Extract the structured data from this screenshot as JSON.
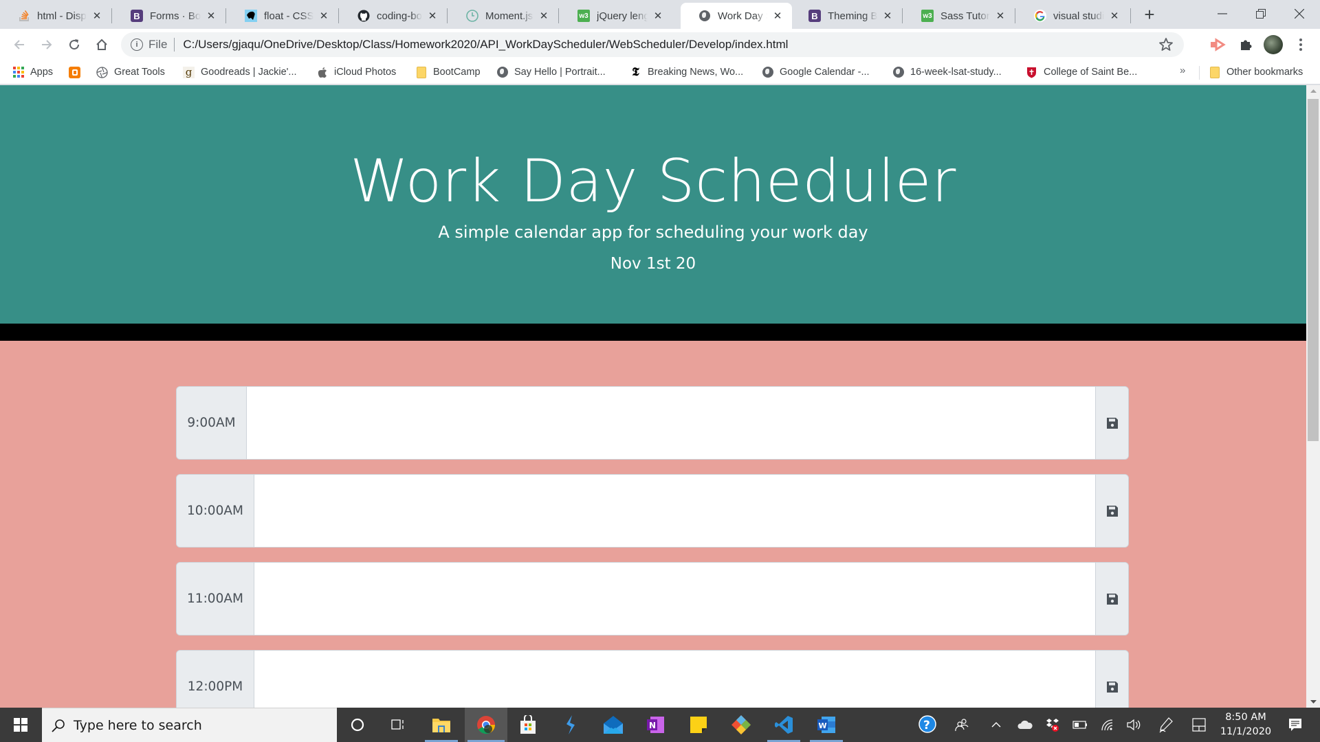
{
  "browser": {
    "tabs": [
      {
        "title": "html - Display",
        "icon": "stackoverflow-icon",
        "active": false
      },
      {
        "title": "Forms · Bootstrap",
        "icon": "bootstrap-icon",
        "active": false
      },
      {
        "title": "float - CSS: C",
        "icon": "mdn-icon",
        "active": false
      },
      {
        "title": "coding-boot",
        "icon": "github-icon",
        "active": false
      },
      {
        "title": "Moment.js |",
        "icon": "moment-icon",
        "active": false
      },
      {
        "title": "jQuery length",
        "icon": "w3schools-icon",
        "active": false
      },
      {
        "title": "Work Day Sc",
        "icon": "globe-icon",
        "active": true
      },
      {
        "title": "Theming Boo",
        "icon": "bootstrap-icon",
        "active": false
      },
      {
        "title": "Sass Tutorial",
        "icon": "w3schools-icon",
        "active": false
      },
      {
        "title": "visual studio",
        "icon": "google-icon",
        "active": false
      }
    ],
    "new_tab_label": "+",
    "address": {
      "scheme_label": "File",
      "url": "C:/Users/gjaqu/OneDrive/Desktop/Class/Homework2020/API_WorkDayScheduler/WebScheduler/Develop/index.html"
    },
    "bookmarks": [
      {
        "label": "Apps",
        "icon": "apps-grid-icon"
      },
      {
        "label": "",
        "icon": "blogger-icon"
      },
      {
        "label": "Great Tools",
        "icon": "aperture-icon"
      },
      {
        "label": "Goodreads | Jackie'...",
        "icon": "goodreads-icon"
      },
      {
        "label": "iCloud Photos",
        "icon": "apple-icon"
      },
      {
        "label": "BootCamp",
        "icon": "folder-icon"
      },
      {
        "label": "Say Hello | Portrait...",
        "icon": "globe-icon"
      },
      {
        "label": "Breaking News, Wo...",
        "icon": "nytimes-icon"
      },
      {
        "label": "Google Calendar -...",
        "icon": "globe-icon"
      },
      {
        "label": "16-week-lsat-study...",
        "icon": "globe-icon"
      },
      {
        "label": "College of Saint Be...",
        "icon": "shield-icon"
      }
    ],
    "bookmarks_overflow": "»",
    "other_bookmarks": "Other bookmarks"
  },
  "page": {
    "title": "Work Day Scheduler",
    "lead": "A simple calendar app for scheduling your work day",
    "current_day": "Nov 1st 20",
    "colors": {
      "header_bg": "#378f87",
      "divider": "#000000",
      "body_bg": "#e8a19a",
      "hour_bg": "#e9ecef"
    },
    "timeblocks": [
      {
        "hour": "9:00AM",
        "description": ""
      },
      {
        "hour": "10:00AM",
        "description": ""
      },
      {
        "hour": "11:00AM",
        "description": ""
      },
      {
        "hour": "12:00PM",
        "description": ""
      }
    ]
  },
  "taskbar": {
    "search_placeholder": "Type here to search",
    "apps": [
      "cortana-icon",
      "task-view-icon",
      "file-explorer-icon",
      "chrome-icon",
      "microsoft-store-icon",
      "visual-studio-icon",
      "mail-icon",
      "onenote-icon",
      "sticky-notes-icon",
      "git-icon",
      "vscode-icon",
      "word-icon"
    ],
    "time": "8:50 AM",
    "date": "11/1/2020"
  }
}
